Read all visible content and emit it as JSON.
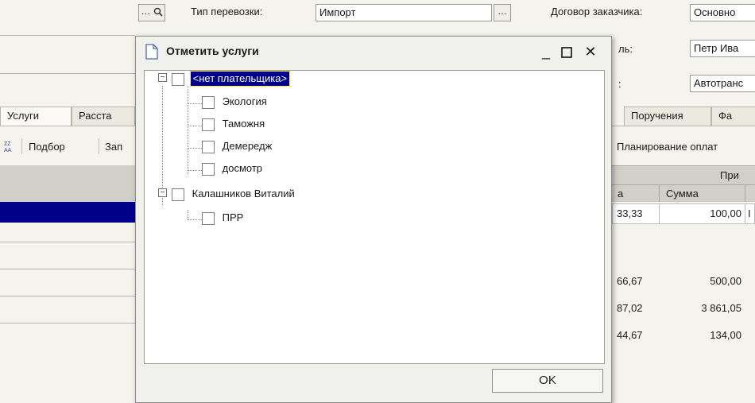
{
  "form": {
    "lookup_btn": "…",
    "transport_label": "Тип перевозки:",
    "transport_value": "Импорт",
    "transport_btn": "…",
    "contract_label": "Договор заказчика:",
    "contract_value": "Основно",
    "recipient_label_tail": "ль:",
    "recipient_value": "Петр Ива",
    "carrier_label_tail": ":",
    "carrier_value": "Автотранс"
  },
  "tabs_left": [
    "Услуги",
    "Расста"
  ],
  "tabs_right": [
    "Поручения",
    "Фа"
  ],
  "toolbar": {
    "podbor": "Подбор",
    "zap": "Зап",
    "planning": "Планирование оплат"
  },
  "table": {
    "group_header": "При",
    "col_a": "а",
    "col_sum": "Сумма",
    "rows": [
      {
        "a": "33,33",
        "sum": "100,00",
        "extra": "I"
      },
      {
        "a": "",
        "sum": "",
        "extra": ""
      },
      {
        "a": "66,67",
        "sum": "500,00",
        "extra": ""
      },
      {
        "a": "87,02",
        "sum": "3 861,05",
        "extra": ""
      },
      {
        "a": "44,67",
        "sum": "134,00",
        "extra": ""
      }
    ]
  },
  "dialog": {
    "title": "Отметить услуги",
    "minimize": "_",
    "maximize": "☐",
    "close": "✕",
    "tree": [
      {
        "label": "<нет плательщика>",
        "children": [
          "Экология",
          "Таможня",
          "Демередж",
          "досмотр"
        ]
      },
      {
        "label": "Калашников Виталий",
        "children": [
          "ПРР"
        ]
      }
    ],
    "ok_label": "OK"
  },
  "colors": {
    "selection": "#00008b",
    "window_bg": "#f4f3ee"
  }
}
